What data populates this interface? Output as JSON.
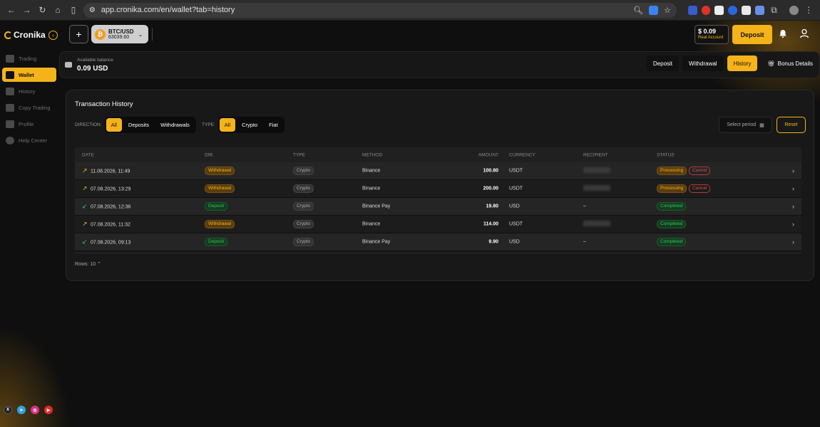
{
  "browser": {
    "url": "app.cronika.com/en/wallet?tab=history"
  },
  "topbar": {
    "logo": "Cronika",
    "pair_name": "BTC/USD",
    "pair_price": "63039.60",
    "account_balance": "$ 0.09",
    "account_type": "Real Account",
    "deposit_label": "Deposit"
  },
  "sidebar": {
    "items": [
      {
        "label": "Trading",
        "icon": "chart-icon"
      },
      {
        "label": "Wallet",
        "icon": "wallet-icon"
      },
      {
        "label": "History",
        "icon": "history-icon"
      },
      {
        "label": "Copy Trading",
        "icon": "copy-icon"
      },
      {
        "label": "Profile",
        "icon": "profile-icon"
      },
      {
        "label": "Help Center",
        "icon": "help-icon"
      }
    ]
  },
  "balance": {
    "label": "Available balance",
    "value": "0.09 USD",
    "tabs": [
      "Deposit",
      "Withdrawal",
      "History",
      "Bonus Details"
    ]
  },
  "history": {
    "title": "Transaction History",
    "direction_label": "DIRECTION:",
    "direction_options": [
      "All",
      "Deposits",
      "Withdrawals"
    ],
    "type_label": "TYPE:",
    "type_options": [
      "All",
      "Crypto",
      "Fiat"
    ],
    "period_placeholder": "Select period",
    "reset_label": "Reset",
    "columns": [
      "DATE",
      "DIR.",
      "TYPE",
      "METHOD",
      "AMOUNT",
      "CURRENCY",
      "RECIPIENT",
      "STATUS"
    ],
    "rows": [
      {
        "date": "11.08.2026, 11:49",
        "dir": "Withdrawal",
        "type": "Crypto",
        "method": "Binance",
        "amount": "100.80",
        "currency": "USDT",
        "recipient": "",
        "status": "Processing",
        "cancel": "Cancel"
      },
      {
        "date": "07.08.2026, 13:29",
        "dir": "Withdrawal",
        "type": "Crypto",
        "method": "Binance",
        "amount": "200.00",
        "currency": "USDT",
        "recipient": "",
        "status": "Processing",
        "cancel": "Cancel"
      },
      {
        "date": "07.08.2026, 12:36",
        "dir": "Deposit",
        "type": "Crypto",
        "method": "Binance Pay",
        "amount": "19.80",
        "currency": "USD",
        "recipient": "–",
        "status": "Completed",
        "cancel": ""
      },
      {
        "date": "07.08.2026, 11:32",
        "dir": "Withdrawal",
        "type": "Crypto",
        "method": "Binance",
        "amount": "114.00",
        "currency": "USDT",
        "recipient": "",
        "status": "Completed",
        "cancel": ""
      },
      {
        "date": "07.08.2026, 09:13",
        "dir": "Deposit",
        "type": "Crypto",
        "method": "Binance Pay",
        "amount": "9.90",
        "currency": "USD",
        "recipient": "–",
        "status": "Completed",
        "cancel": ""
      }
    ],
    "rows_label": "Rows: 10"
  },
  "colors": {
    "accent": "#f5b31a",
    "green": "#3cbf5e",
    "red": "#e04a4a"
  }
}
